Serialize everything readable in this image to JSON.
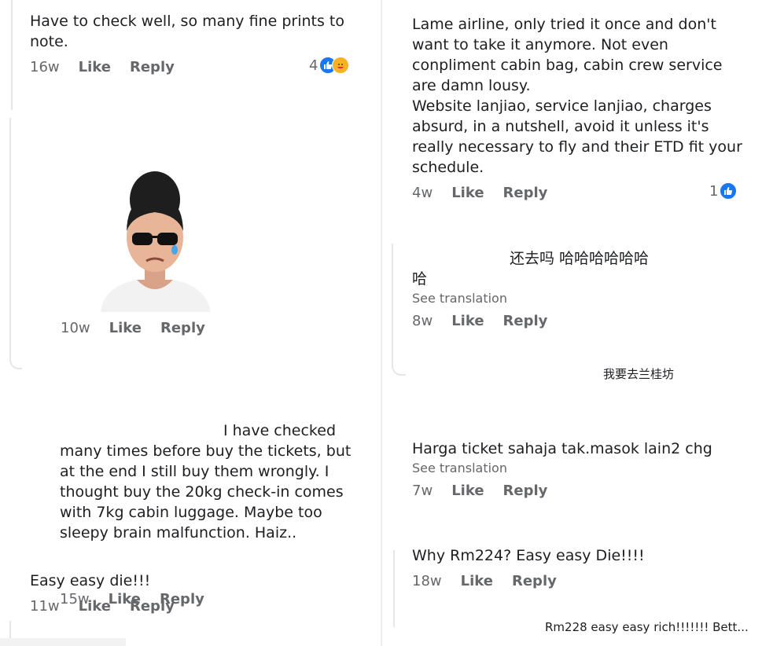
{
  "comments": {
    "c1": {
      "text": "Have to check well, so many fine prints to\nnote.",
      "time": "16w",
      "like": "Like",
      "reply": "Reply",
      "reaction_count": "4"
    },
    "c2": {
      "time": "10w",
      "like": "Like",
      "reply": "Reply"
    },
    "c3": {
      "text": "I have checked\nmany times before buy the tickets, but\nat the end I still buy them wrongly. I\nthought buy the 20kg check-in comes\nwith 7kg cabin luggage. Maybe too\nsleepy brain malfunction. Haiz..",
      "time": "15w",
      "like": "Like",
      "reply": "Reply"
    },
    "c4": {
      "text": "Easy easy die!!!",
      "time": "11w",
      "like": "Like",
      "reply": "Reply"
    },
    "c5": {
      "text": "Lame airline, only tried it once and don't\nwant to take it anymore. Not even\nconpliment cabin bag, cabin crew service\nare damn lousy.\nWebsite lanjiao, service lanjiao, charges\nabsurd, in a nutshell, avoid it unless it's\nreally necessary to fly and their ETD fit your\nschedule.",
      "time": "4w",
      "like": "Like",
      "reply": "Reply",
      "reaction_count": "1"
    },
    "c6": {
      "text": "还去吗 哈哈哈哈哈哈\n哈",
      "see_translation": "See translation",
      "time": "8w",
      "like": "Like",
      "reply": "Reply"
    },
    "c7": {
      "text": "我要去兰桂坊"
    },
    "c8": {
      "text": "Harga ticket sahaja tak.masok lain2 chg",
      "see_translation": "See translation",
      "time": "7w",
      "like": "Like",
      "reply": "Reply"
    },
    "c9": {
      "text": "Why Rm224? Easy easy Die!!!!",
      "time": "18w",
      "like": "Like",
      "reply": "Reply"
    },
    "c10": {
      "text": "Rm228 easy easy rich!!!!!!! Bett..."
    }
  },
  "colors": {
    "like_blue": "#1877f2",
    "meta_gray": "#65676b",
    "care_yellow": "#f7b125"
  },
  "icons": {
    "like": "thumbs-up-icon",
    "care": "care-face-icon"
  }
}
